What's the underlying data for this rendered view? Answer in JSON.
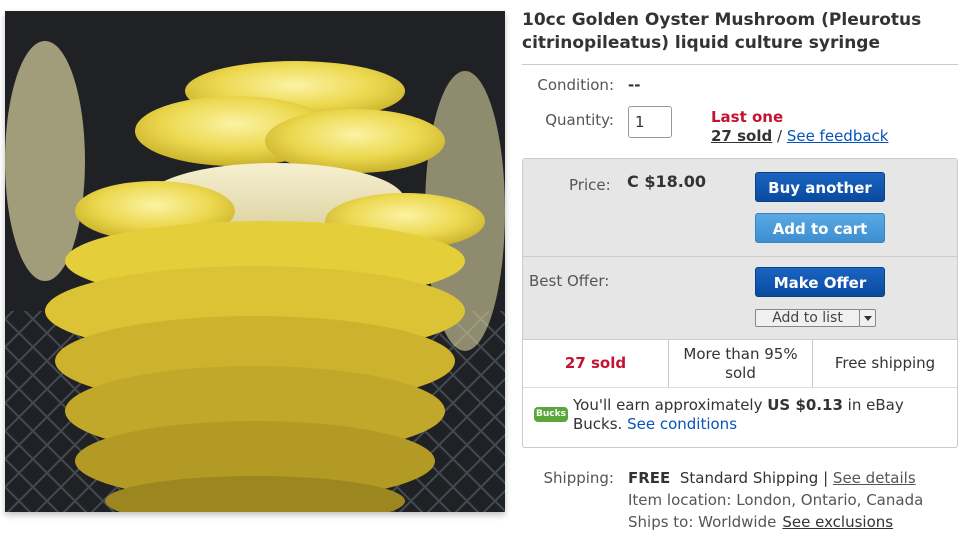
{
  "listing": {
    "title": "10cc Golden Oyster Mushroom (Pleurotus citrinopileatus) liquid culture syringe"
  },
  "condition": {
    "label": "Condition:",
    "value": "--"
  },
  "quantity": {
    "label": "Quantity:",
    "value": "1",
    "last_one": "Last one",
    "sold": "27 sold",
    "separator": " / ",
    "feedback": "See feedback"
  },
  "price": {
    "label": "Price:",
    "value": "C $18.00"
  },
  "buttons": {
    "buy_another": "Buy another",
    "add_to_cart": "Add to cart",
    "make_offer": "Make Offer",
    "add_to_list": "Add to list"
  },
  "best_offer": {
    "label": "Best Offer:"
  },
  "stats": {
    "sold": "27 sold",
    "more_than": "More than 95% sold",
    "shipping": "Free shipping"
  },
  "bucks": {
    "icon_text": "Bucks",
    "text_before": "You'll earn approximately ",
    "amount": "US $0.13",
    "text_after": " in eBay Bucks. ",
    "link": "See conditions"
  },
  "shipping": {
    "label": "Shipping:",
    "free": "FREE",
    "method": "Standard Shipping",
    "separator": "|",
    "details": "See details",
    "location": "Item location: London, Ontario, Canada",
    "ships_to_label": "Ships to: Worldwide",
    "exclusions": "See exclusions"
  },
  "colors": {
    "link": "#0654ba",
    "alert": "#c41230",
    "primary_button": "#0a4aa0",
    "secondary_button": "#3d8fd2",
    "bucks_green": "#5ba63b"
  }
}
